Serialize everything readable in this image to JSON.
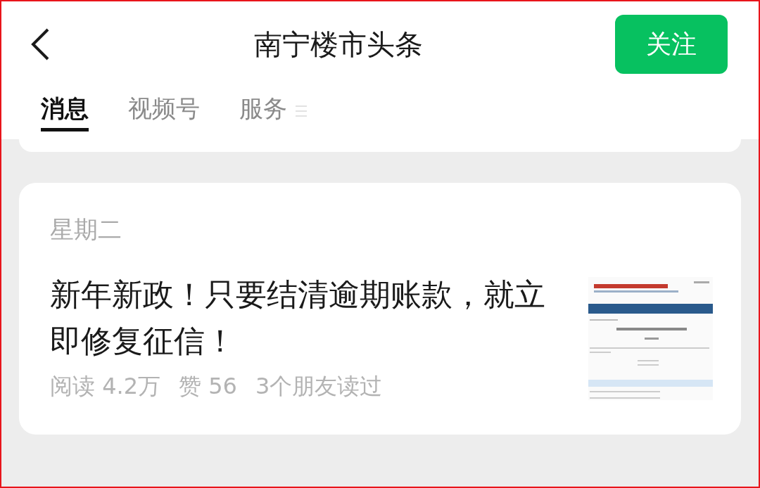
{
  "header": {
    "title": "南宁楼市头条",
    "follow_button": "关注"
  },
  "tabs": [
    {
      "label": "消息",
      "selected": true
    },
    {
      "label": "视频号",
      "selected": false
    },
    {
      "label": "服务",
      "selected": false
    }
  ],
  "articles": [
    {
      "date": "星期二",
      "title": "新年新政！只要结清逾期账款，就立即修复征信！",
      "stats": [
        "阅读 4.2万",
        "赞 56",
        "3个朋友读过"
      ]
    }
  ]
}
